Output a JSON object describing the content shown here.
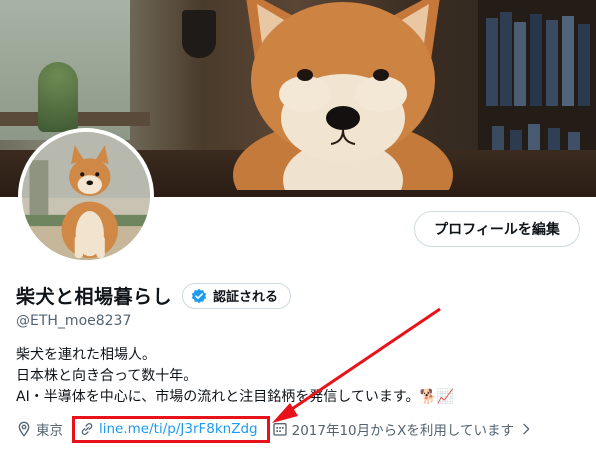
{
  "profile": {
    "edit_button": "プロフィールを編集",
    "display_name": "柴犬と相場暮らし",
    "verify_button": "認証される",
    "handle": "@ETH_moe8237",
    "bio_lines": [
      "柴犬を連れた相場人。",
      "日本株と向き合って数十年。",
      "AI・半導体を中心に、市場の流れと注目銘柄を発信しています。🐕📈"
    ],
    "location": "東京",
    "link": "line.me/ti/p/J3rF8knZdg",
    "joined": "2017年10月からXを利用しています"
  },
  "icons": {
    "location": "location-pin-icon",
    "link": "link-icon",
    "joined": "calendar-icon",
    "chevron": "chevron-right-icon",
    "verify": "verified-badge-icon"
  },
  "colors": {
    "accent": "#1d9bf0",
    "annotation": "#e8131a",
    "secondary_text": "#536471"
  }
}
